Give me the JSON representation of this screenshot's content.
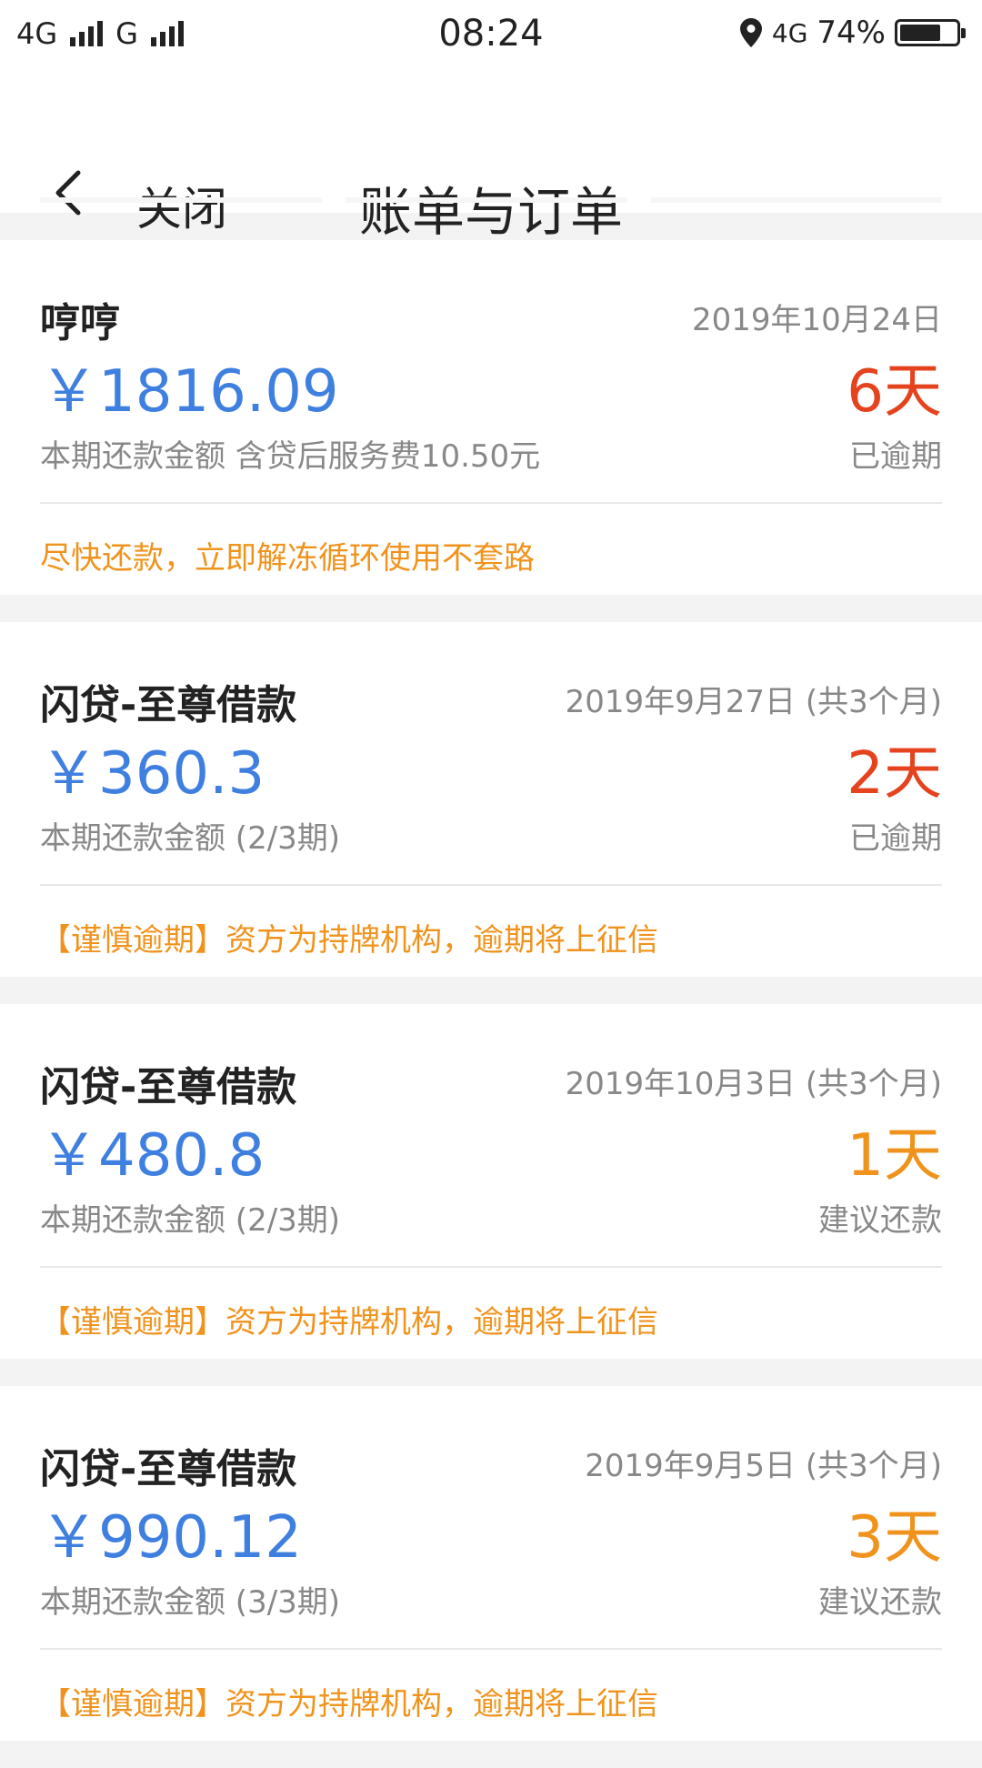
{
  "statusbar": {
    "net1": "4G",
    "net2": "G",
    "time": "08:24",
    "net3": "4G",
    "battery_text": "74%",
    "battery_level": 0.74
  },
  "nav": {
    "close_label": "关闭",
    "title": "账单与订单"
  },
  "colors": {
    "amount": "#3f7fe0",
    "overdue": "#e5431e",
    "suggest": "#f0931d",
    "notice": "#f0931d",
    "muted": "#888888"
  },
  "bills": [
    {
      "name": "哼哼",
      "date": "2019年10月24日",
      "amount": "￥1816.09",
      "days": "6天",
      "days_kind": "overdue",
      "subtitle": "本期还款金额 含贷后服务费10.50元",
      "status": "已逾期",
      "notice": "尽快还款，立即解冻循环使用不套路"
    },
    {
      "name": "闪贷-至尊借款",
      "date": "2019年9月27日 (共3个月)",
      "amount": "￥360.3",
      "days": "2天",
      "days_kind": "overdue",
      "subtitle": "本期还款金额 (2/3期)",
      "status": "已逾期",
      "notice": "【谨慎逾期】资方为持牌机构，逾期将上征信"
    },
    {
      "name": "闪贷-至尊借款",
      "date": "2019年10月3日 (共3个月)",
      "amount": "￥480.8",
      "days": "1天",
      "days_kind": "suggest",
      "subtitle": "本期还款金额 (2/3期)",
      "status": "建议还款",
      "notice": "【谨慎逾期】资方为持牌机构，逾期将上征信"
    },
    {
      "name": "闪贷-至尊借款",
      "date": "2019年9月5日 (共3个月)",
      "amount": "￥990.12",
      "days": "3天",
      "days_kind": "suggest",
      "subtitle": "本期还款金额 (3/3期)",
      "status": "建议还款",
      "notice": "【谨慎逾期】资方为持牌机构，逾期将上征信"
    }
  ]
}
